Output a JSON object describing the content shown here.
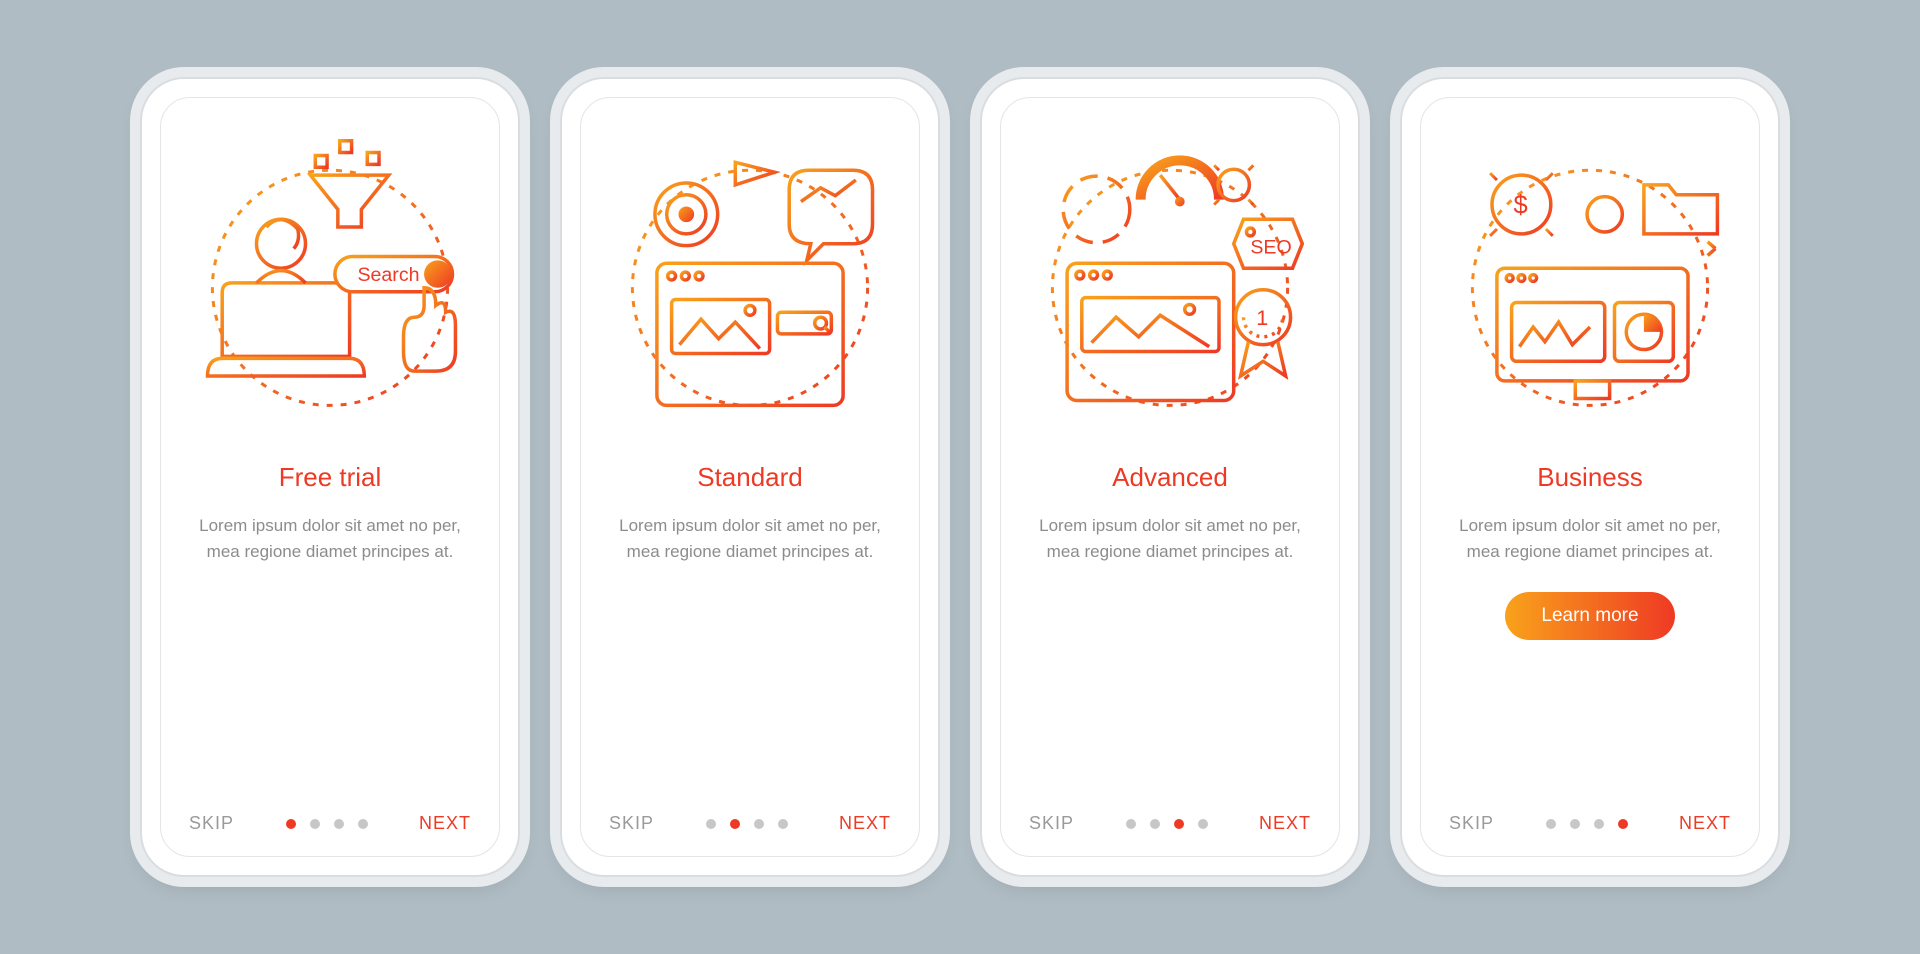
{
  "common": {
    "skip": "SKIP",
    "next": "NEXT",
    "description": "Lorem ipsum dolor sit amet no per, mea regione diamet principes at.",
    "learn_more": "Learn more",
    "search_label": "Search",
    "seo_label": "SEO",
    "badge_number": "1"
  },
  "slides": [
    {
      "title": "Free trial",
      "active_dot": 0,
      "has_cta": false,
      "icon": "search-person"
    },
    {
      "title": "Standard",
      "active_dot": 1,
      "has_cta": false,
      "icon": "standard-web"
    },
    {
      "title": "Advanced",
      "active_dot": 2,
      "has_cta": false,
      "icon": "advanced-seo"
    },
    {
      "title": "Business",
      "active_dot": 3,
      "has_cta": true,
      "icon": "business-monitor"
    }
  ],
  "colors": {
    "accent": "#ee3a24",
    "grad_a": "#f9a21b",
    "grad_b": "#ee3a24",
    "muted": "#8c8c8c"
  }
}
